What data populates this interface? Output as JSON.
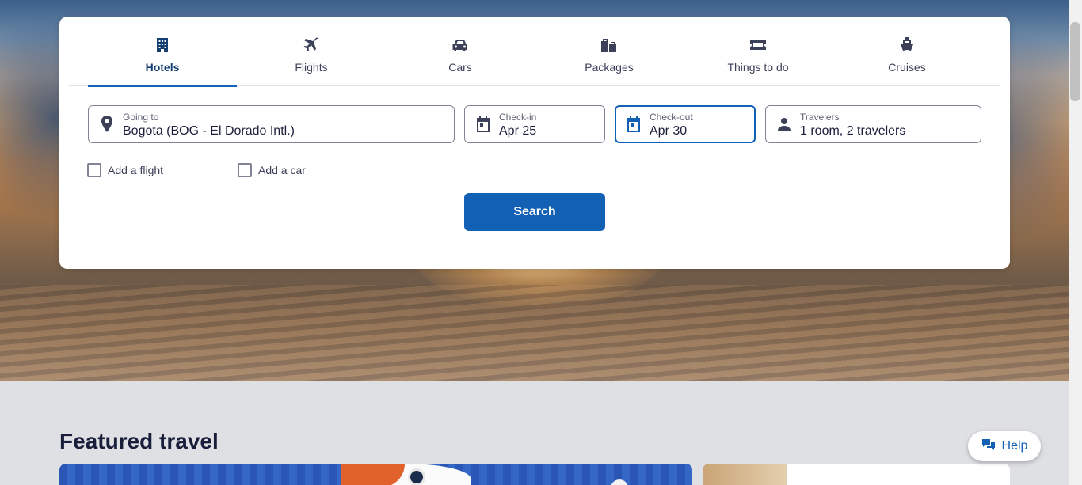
{
  "tabs": [
    {
      "label": "Hotels",
      "icon": "building-icon",
      "active": true
    },
    {
      "label": "Flights",
      "icon": "plane-icon",
      "active": false
    },
    {
      "label": "Cars",
      "icon": "car-icon",
      "active": false
    },
    {
      "label": "Packages",
      "icon": "luggage-icon",
      "active": false
    },
    {
      "label": "Things to do",
      "icon": "ticket-icon",
      "active": false
    },
    {
      "label": "Cruises",
      "icon": "ship-icon",
      "active": false
    }
  ],
  "search": {
    "going_to": {
      "label": "Going to",
      "value": "Bogota (BOG - El Dorado Intl.)"
    },
    "check_in": {
      "label": "Check-in",
      "value": "Apr 25"
    },
    "check_out": {
      "label": "Check-out",
      "value": "Apr 30"
    },
    "travelers": {
      "label": "Travelers",
      "value": "1 room, 2 travelers"
    },
    "add_flight": "Add a flight",
    "add_car": "Add a car",
    "button_label": "Search"
  },
  "featured": {
    "title": "Featured travel"
  },
  "help": {
    "label": "Help"
  },
  "colors": {
    "accent": "#1361b4",
    "active_tab_text": "#153e72",
    "text": "#191e3b",
    "page_bg": "#dfe0e4"
  }
}
